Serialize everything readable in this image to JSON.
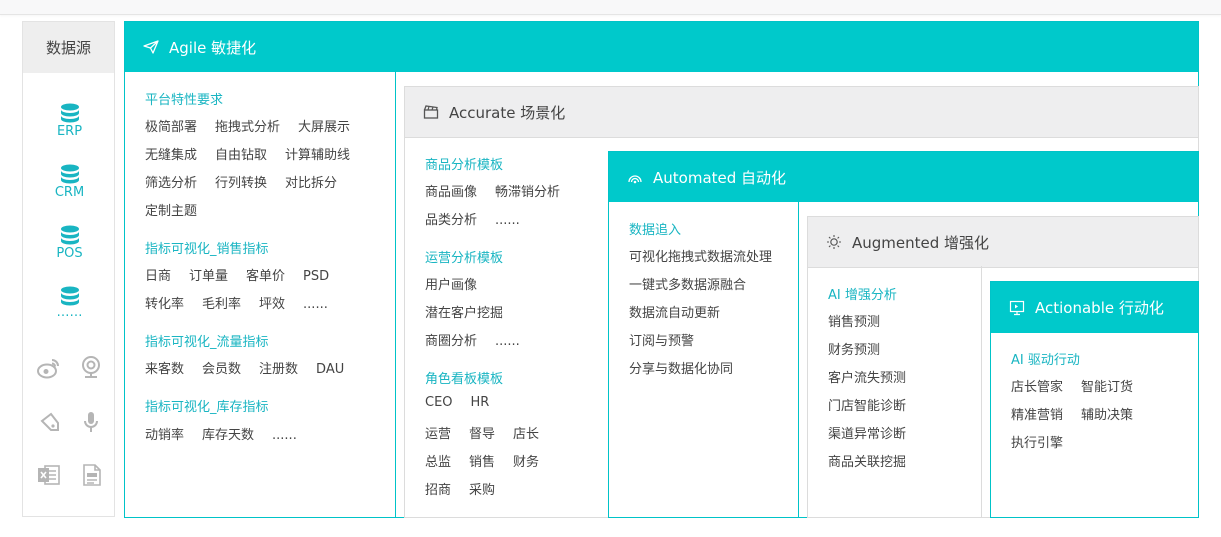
{
  "datasource": {
    "title": "数据源",
    "items": [
      {
        "label": "ERP",
        "icon": "database-icon"
      },
      {
        "label": "CRM",
        "icon": "database-icon"
      },
      {
        "label": "POS",
        "icon": "database-icon"
      },
      {
        "label": "……",
        "icon": "database-icon"
      }
    ],
    "gray_icons": [
      "weibo-icon",
      "webcam-icon",
      "tag-icon",
      "microphone-icon",
      "excel-icon",
      "document-icon"
    ]
  },
  "agile": {
    "title": "Agile 敏捷化",
    "icon": "send-icon",
    "sections": [
      {
        "title": "平台特性要求",
        "rows": [
          [
            "极简部署",
            "拖拽式分析",
            "大屏展示"
          ],
          [
            "无缝集成",
            "自由钻取",
            "计算辅助线"
          ],
          [
            "筛选分析",
            "行列转换",
            "对比拆分"
          ],
          [
            "定制主题"
          ]
        ]
      },
      {
        "title": "指标可视化_销售指标",
        "rows": [
          [
            "日商",
            "订单量",
            "客单价",
            "PSD"
          ],
          [
            "转化率",
            "毛利率",
            "坪效",
            "......"
          ]
        ]
      },
      {
        "title": "指标可视化_流量指标",
        "rows": [
          [
            "来客数",
            "会员数",
            "注册数",
            "DAU"
          ]
        ]
      },
      {
        "title": "指标可视化_库存指标",
        "rows": [
          [
            "动销率",
            "库存天数",
            "......"
          ]
        ]
      }
    ]
  },
  "accurate": {
    "title": "Accurate 场景化",
    "icon": "clapperboard-icon",
    "sections": [
      {
        "title": "商品分析模板",
        "rows": [
          [
            "商品画像",
            "畅滞销分析"
          ],
          [
            "品类分析",
            "......"
          ]
        ]
      },
      {
        "title": "运营分析模板",
        "rows": [
          [
            "用户画像"
          ],
          [
            "潜在客户挖掘"
          ],
          [
            "商圈分析",
            "......"
          ]
        ]
      },
      {
        "title": "角色看板模板",
        "rows": [
          [
            "CEO",
            "HR"
          ],
          [
            "运营",
            "督导",
            "店长"
          ],
          [
            "总监",
            "销售",
            "财务"
          ],
          [
            "招商",
            "采购"
          ]
        ]
      }
    ]
  },
  "automated": {
    "title": "Automated 自动化",
    "icon": "signal-icon",
    "sections": [
      {
        "title": "数据追入",
        "rows": [
          [
            "可视化拖拽式数据流处理"
          ],
          [
            "一键式多数据源融合"
          ],
          [
            "数据流自动更新"
          ],
          [
            "订阅与预警"
          ],
          [
            "分享与数据化协同"
          ]
        ]
      }
    ]
  },
  "augmented": {
    "title": "Augmented 增强化",
    "icon": "bulb-icon",
    "sections": [
      {
        "title": "AI 增强分析",
        "rows": [
          [
            "销售预测"
          ],
          [
            "财务预测"
          ],
          [
            "客户流失预测"
          ],
          [
            "门店智能诊断"
          ],
          [
            "渠道异常诊断"
          ],
          [
            "商品关联挖掘"
          ]
        ]
      }
    ]
  },
  "actionable": {
    "title": "Actionable 行动化",
    "icon": "monitor-icon",
    "sections": [
      {
        "title": "AI 驱动行动",
        "rows": [
          [
            "店长管家",
            "智能订货"
          ],
          [
            "精准营销",
            "辅助决策"
          ],
          [
            "执行引擎"
          ]
        ]
      }
    ]
  }
}
